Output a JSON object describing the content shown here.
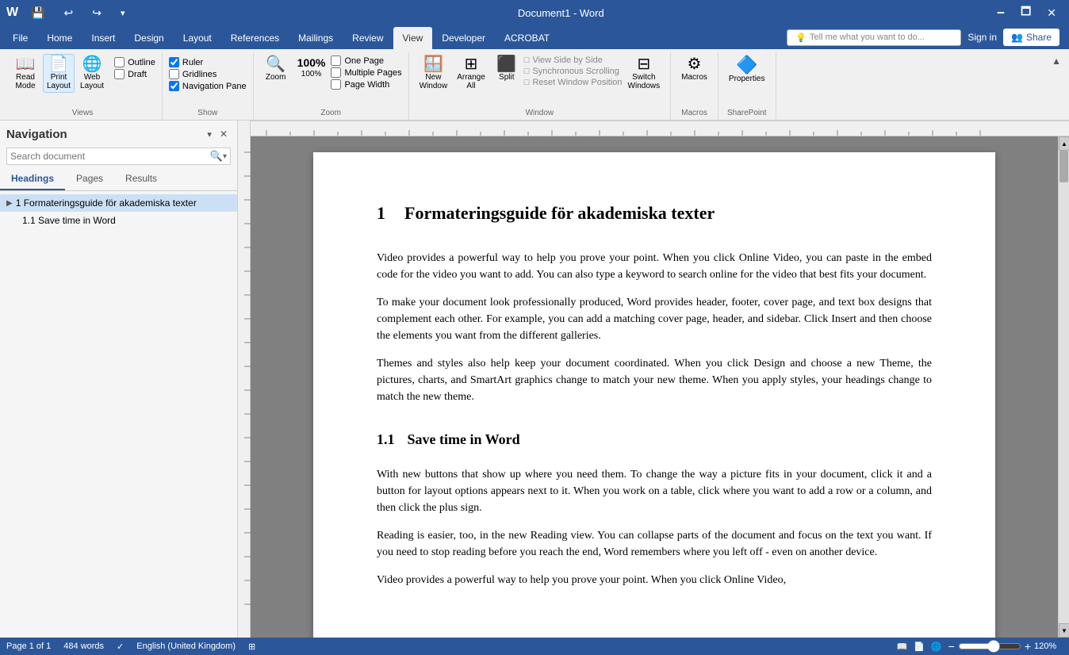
{
  "titlebar": {
    "title": "Document1 - Word",
    "minimize": "🗕",
    "maximize": "🗖",
    "close": "✕"
  },
  "quickaccess": {
    "save": "💾",
    "undo": "↩",
    "redo": "↪",
    "more": "▾"
  },
  "tabs": [
    {
      "id": "file",
      "label": "File"
    },
    {
      "id": "home",
      "label": "Home"
    },
    {
      "id": "insert",
      "label": "Insert"
    },
    {
      "id": "design",
      "label": "Design"
    },
    {
      "id": "layout",
      "label": "Layout"
    },
    {
      "id": "references",
      "label": "References"
    },
    {
      "id": "mailings",
      "label": "Mailings"
    },
    {
      "id": "review",
      "label": "Review"
    },
    {
      "id": "view",
      "label": "View",
      "active": true
    },
    {
      "id": "developer",
      "label": "Developer"
    },
    {
      "id": "acrobat",
      "label": "ACROBAT"
    }
  ],
  "ribbon": {
    "views_group": {
      "label": "Views",
      "buttons": [
        {
          "id": "read-mode",
          "icon": "📖",
          "label": "Read\nMode"
        },
        {
          "id": "print-layout",
          "icon": "📄",
          "label": "Print\nLayout",
          "active": true
        },
        {
          "id": "web-layout",
          "icon": "🌐",
          "label": "Web\nLayout"
        }
      ],
      "checkboxes": [
        {
          "id": "outline",
          "label": "Outline",
          "checked": false
        },
        {
          "id": "draft",
          "label": "Draft",
          "checked": false
        }
      ]
    },
    "show_group": {
      "label": "Show",
      "checkboxes": [
        {
          "id": "ruler",
          "label": "Ruler",
          "checked": true
        },
        {
          "id": "gridlines",
          "label": "Gridlines",
          "checked": false
        },
        {
          "id": "navigation-pane",
          "label": "Navigation Pane",
          "checked": true
        }
      ]
    },
    "zoom_group": {
      "label": "Zoom",
      "buttons": [
        {
          "id": "zoom",
          "icon": "🔍",
          "label": "Zoom"
        },
        {
          "id": "zoom-100",
          "icon": "100%",
          "label": "100%"
        },
        {
          "id": "one-page",
          "label": "One Page"
        },
        {
          "id": "multiple-pages",
          "label": "Multiple Pages"
        },
        {
          "id": "page-width",
          "label": "Page Width"
        }
      ]
    },
    "window_group": {
      "label": "Window",
      "buttons": [
        {
          "id": "new-window",
          "icon": "🪟",
          "label": "New\nWindow"
        },
        {
          "id": "arrange-all",
          "icon": "⊞",
          "label": "Arrange\nAll"
        },
        {
          "id": "split",
          "icon": "⬜",
          "label": "Split"
        }
      ],
      "small_buttons": [
        {
          "id": "view-side-by-side",
          "label": "View Side by Side"
        },
        {
          "id": "synchronous-scrolling",
          "label": "Synchronous Scrolling"
        },
        {
          "id": "reset-window-position",
          "label": "Reset Window Position"
        }
      ],
      "switch_windows": {
        "label": "Switch\nWindows"
      }
    },
    "macros_group": {
      "label": "Macros",
      "buttons": [
        {
          "id": "macros",
          "icon": "⚙",
          "label": "Macros"
        }
      ]
    },
    "sharepoint_group": {
      "label": "SharePoint",
      "buttons": [
        {
          "id": "properties",
          "icon": "📋",
          "label": "Properties"
        }
      ]
    }
  },
  "tell_me": {
    "placeholder": "Tell me what you want to do...",
    "icon": "💡"
  },
  "user": {
    "sign_in": "Sign in",
    "share": "Share",
    "share_icon": "👥"
  },
  "navigation": {
    "title": "Navigation",
    "search_placeholder": "Search document",
    "tabs": [
      {
        "id": "headings",
        "label": "Headings",
        "active": true
      },
      {
        "id": "pages",
        "label": "Pages"
      },
      {
        "id": "results",
        "label": "Results"
      }
    ],
    "tree": [
      {
        "id": "h1-1",
        "level": 1,
        "text": "1  Formateringsguide för akademiska texter",
        "expanded": true,
        "selected": true,
        "children": [
          {
            "id": "h2-1",
            "level": 2,
            "text": "1.1  Save time in Word"
          }
        ]
      }
    ]
  },
  "document": {
    "h1": {
      "number": "1",
      "text": "Formateringsguide för akademiska texter"
    },
    "paragraphs": [
      "Video provides a powerful way to help you prove your point. When you click Online Video, you can paste in the embed code for the video you want to add. You can also type a keyword to search online for the video that best fits your document.",
      "To make your document look professionally produced, Word provides header, footer, cover page, and text box designs that complement each other. For example, you can add a matching cover page, header, and sidebar. Click Insert and then choose the elements you want from the different galleries.",
      "Themes and styles also help keep your document coordinated. When you click Design and choose a new Theme, the pictures, charts, and SmartArt graphics change to match your new theme. When you apply styles, your headings change to match the new theme."
    ],
    "h2": {
      "number": "1.1",
      "text": "Save time in Word"
    },
    "paragraphs2": [
      "With new buttons that show up where you need them. To change the way a picture fits in your document, click it and a button for layout options appears next to it. When you work on a table, click where you want to add a row or a column, and then click the plus sign.",
      "Reading is easier, too, in the new Reading view. You can collapse parts of the document and focus on the text you want. If you need to stop reading before you reach the end, Word remembers where you left off - even on another device.",
      "Video provides a powerful way to help you prove your point. When you click Online Video,"
    ]
  },
  "statusbar": {
    "page_info": "Page 1 of 1",
    "word_count": "484 words",
    "language": "English (United Kingdom)",
    "zoom": "120%",
    "zoom_min_icon": "−",
    "zoom_plus_icon": "+"
  },
  "colors": {
    "accent": "#2b579a",
    "ribbon_bg": "#f0f0f0",
    "nav_selected": "#cce0f5"
  }
}
